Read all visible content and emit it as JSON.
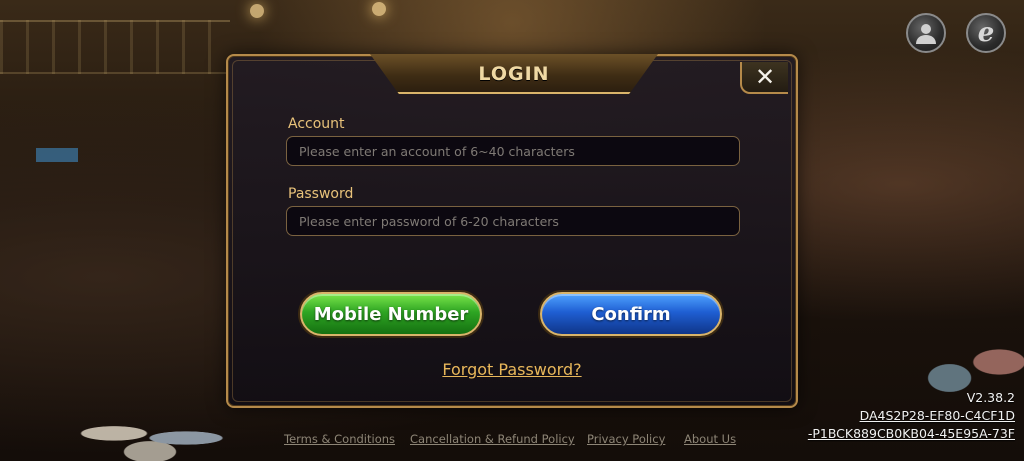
{
  "dialog": {
    "title": "LOGIN",
    "close_symbol": "✕",
    "account": {
      "label": "Account",
      "value": "",
      "placeholder": "Please enter an account of 6~40 characters"
    },
    "password": {
      "label": "Password",
      "value": "",
      "placeholder": "Please enter password of 6-20 characters"
    },
    "mobile_button": "Mobile Number",
    "confirm_button": "Confirm",
    "forgot_link": "Forgot Password?"
  },
  "top_icons": [
    {
      "name": "user-service-icon"
    },
    {
      "name": "browser-e-icon",
      "glyph": "e"
    }
  ],
  "footer": {
    "links": [
      "Terms & Conditions",
      "Cancellation & Refund Policy",
      "Privacy Policy",
      "About Us"
    ]
  },
  "version": {
    "number": "V2.38.2",
    "device_id_line1": "DA4S2P28-EF80-C4CF1D",
    "device_id_line2": "-P1BCK889CB0KB04-45E95A-73F"
  },
  "colors": {
    "accent_gold": "#e8c27a",
    "green_button": "#2ea523",
    "blue_button": "#1f5fd3"
  }
}
